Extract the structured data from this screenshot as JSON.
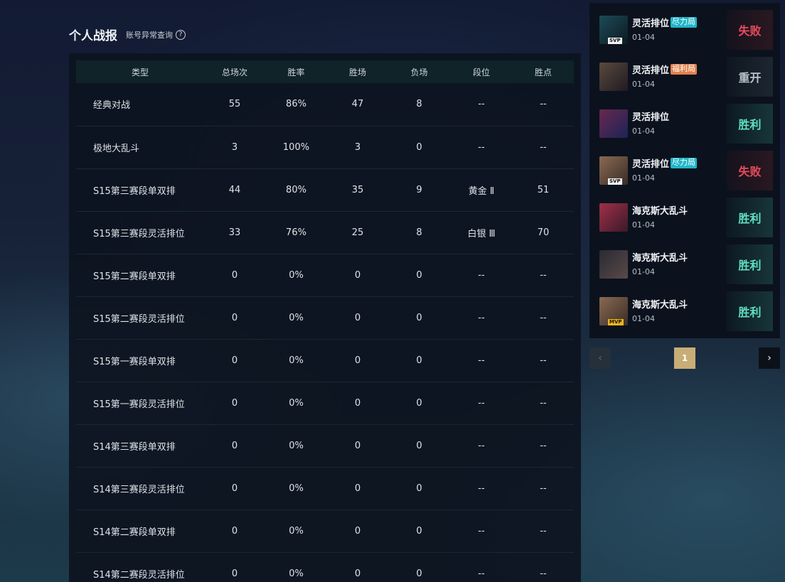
{
  "header": {
    "title": "个人战报",
    "sub_link": "账号异常查询",
    "help_glyph": "?"
  },
  "stats": {
    "columns": [
      "类型",
      "总场次",
      "胜率",
      "胜场",
      "负场",
      "段位",
      "胜点"
    ],
    "rows": [
      [
        "经典对战",
        "55",
        "86%",
        "47",
        "8",
        "--",
        "--"
      ],
      [
        "极地大乱斗",
        "3",
        "100%",
        "3",
        "0",
        "--",
        "--"
      ],
      [
        "S15第三赛段单双排",
        "44",
        "80%",
        "35",
        "9",
        "黄金 Ⅱ",
        "51"
      ],
      [
        "S15第三赛段灵活排位",
        "33",
        "76%",
        "25",
        "8",
        "白银 Ⅲ",
        "70"
      ],
      [
        "S15第二赛段单双排",
        "0",
        "0%",
        "0",
        "0",
        "--",
        "--"
      ],
      [
        "S15第二赛段灵活排位",
        "0",
        "0%",
        "0",
        "0",
        "--",
        "--"
      ],
      [
        "S15第一赛段单双排",
        "0",
        "0%",
        "0",
        "0",
        "--",
        "--"
      ],
      [
        "S15第一赛段灵活排位",
        "0",
        "0%",
        "0",
        "0",
        "--",
        "--"
      ],
      [
        "S14第三赛段单双排",
        "0",
        "0%",
        "0",
        "0",
        "--",
        "--"
      ],
      [
        "S14第三赛段灵活排位",
        "0",
        "0%",
        "0",
        "0",
        "--",
        "--"
      ],
      [
        "S14第二赛段单双排",
        "0",
        "0%",
        "0",
        "0",
        "--",
        "--"
      ],
      [
        "S14第二赛段灵活排位",
        "0",
        "0%",
        "0",
        "0",
        "--",
        "--"
      ]
    ]
  },
  "matches": [
    {
      "mode": "灵活排位",
      "tag": "尽力局",
      "tag_color": "#1fb6c9",
      "date": "01-04",
      "result": "失败",
      "result_kind": "lose",
      "badge": "SVP",
      "avatar_colors": [
        "#1d4b57",
        "#0c1a22"
      ]
    },
    {
      "mode": "灵活排位",
      "tag": "福利局",
      "tag_color": "#e0804a",
      "date": "01-04",
      "result": "重开",
      "result_kind": "remake",
      "badge": "",
      "avatar_colors": [
        "#5a4a3c",
        "#1f1a22"
      ]
    },
    {
      "mode": "灵活排位",
      "tag": "",
      "tag_color": "",
      "date": "01-04",
      "result": "胜利",
      "result_kind": "win",
      "badge": "",
      "avatar_colors": [
        "#6a2750",
        "#1b2456"
      ]
    },
    {
      "mode": "灵活排位",
      "tag": "尽力局",
      "tag_color": "#1fb6c9",
      "date": "01-04",
      "result": "失败",
      "result_kind": "lose",
      "badge": "SVP",
      "avatar_colors": [
        "#8a6a52",
        "#3a2c26"
      ]
    },
    {
      "mode": "海克斯大乱斗",
      "tag": "",
      "tag_color": "",
      "date": "01-04",
      "result": "胜利",
      "result_kind": "win",
      "badge": "",
      "avatar_colors": [
        "#a0304a",
        "#3a1a28"
      ]
    },
    {
      "mode": "海克斯大乱斗",
      "tag": "",
      "tag_color": "",
      "date": "01-04",
      "result": "胜利",
      "result_kind": "win",
      "badge": "",
      "avatar_colors": [
        "#2a2a34",
        "#594a48"
      ]
    },
    {
      "mode": "海克斯大乱斗",
      "tag": "",
      "tag_color": "",
      "date": "01-04",
      "result": "胜利",
      "result_kind": "win",
      "badge": "MVP",
      "avatar_colors": [
        "#8a6a52",
        "#3a2c26"
      ]
    }
  ],
  "pagination": {
    "prev_glyph": "‹",
    "current_page": "1",
    "next_glyph": "›"
  }
}
